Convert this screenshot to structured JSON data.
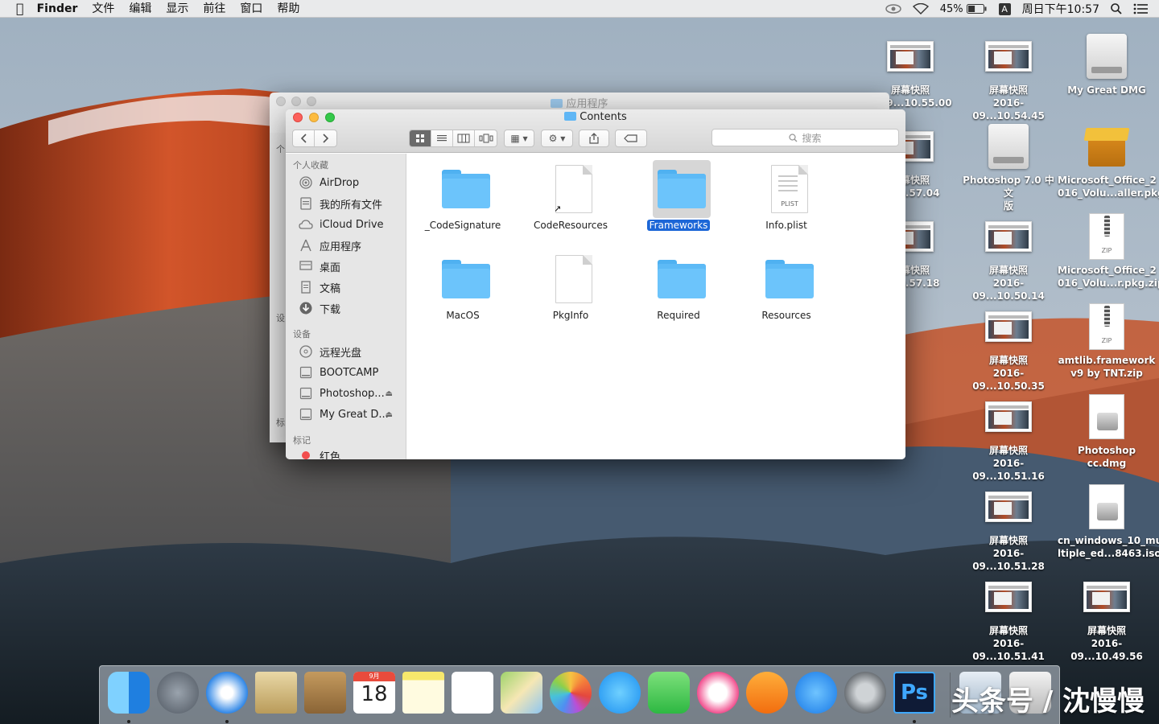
{
  "menubar": {
    "app_name": "Finder",
    "menus": [
      "文件",
      "编辑",
      "显示",
      "前往",
      "窗口",
      "帮助"
    ],
    "battery": "45%",
    "input_method": "A",
    "clock": "周日下午10:57"
  },
  "back_window": {
    "title": "应用程序",
    "sidebar_fragments": [
      "个",
      "设",
      "标"
    ]
  },
  "finder": {
    "title": "Contents",
    "search_placeholder": "搜索",
    "sidebar": {
      "favorites_header": "个人收藏",
      "favorites": [
        {
          "label": "AirDrop",
          "icon": "airdrop-icon"
        },
        {
          "label": "我的所有文件",
          "icon": "all-files-icon"
        },
        {
          "label": "iCloud Drive",
          "icon": "cloud-icon"
        },
        {
          "label": "应用程序",
          "icon": "applications-icon"
        },
        {
          "label": "桌面",
          "icon": "desktop-icon"
        },
        {
          "label": "文稿",
          "icon": "documents-icon"
        },
        {
          "label": "下载",
          "icon": "download-icon"
        }
      ],
      "devices_header": "设备",
      "devices": [
        {
          "label": "远程光盘",
          "icon": "disc-icon"
        },
        {
          "label": "BOOTCAMP",
          "icon": "drive-icon"
        },
        {
          "label": "Photoshop...",
          "icon": "drive-icon",
          "eject": true
        },
        {
          "label": "My Great D...",
          "icon": "drive-icon",
          "eject": true
        }
      ],
      "tags_header": "标记",
      "tags": [
        {
          "label": "红色",
          "color": "#f24e4e"
        }
      ]
    },
    "files": [
      {
        "name": "_CodeSignature",
        "kind": "folder"
      },
      {
        "name": "CodeResources",
        "kind": "alias-doc"
      },
      {
        "name": "Frameworks",
        "kind": "folder",
        "selected": true
      },
      {
        "name": "Info.plist",
        "kind": "plist",
        "badge": "PLIST"
      },
      {
        "name": "MacOS",
        "kind": "folder"
      },
      {
        "name": "PkgInfo",
        "kind": "doc"
      },
      {
        "name": "Required",
        "kind": "folder"
      },
      {
        "name": "Resources",
        "kind": "folder"
      }
    ]
  },
  "desktop_icons": [
    {
      "l1": "屏幕快照",
      "l2": "...09...10.55.00",
      "kind": "screenshot"
    },
    {
      "l1": "屏幕快照",
      "l2": "2016-09...10.54.45",
      "kind": "screenshot"
    },
    {
      "l1": "My Great DMG",
      "l2": "",
      "kind": "dmg"
    },
    {
      "l1": "屏幕快照",
      "l2": "...10.57.04",
      "kind": "screenshot"
    },
    {
      "l1": "Photoshop 7.0 中文",
      "l2": "版",
      "kind": "dmg"
    },
    {
      "l1": "Microsoft_Office_2",
      "l2": "016_Volu...aller.pkg",
      "kind": "pkg"
    },
    {
      "l1": "屏幕快照",
      "l2": "...10.57.18",
      "kind": "screenshot"
    },
    {
      "l1": "屏幕快照",
      "l2": "2016-09...10.50.14",
      "kind": "screenshot"
    },
    {
      "l1": "Microsoft_Office_2",
      "l2": "016_Volu...r.pkg.zip",
      "kind": "zip"
    },
    {
      "l1": "屏幕快照",
      "l2": "2016-09...10.50.35",
      "kind": "screenshot"
    },
    {
      "l1": "amtlib.framework",
      "l2": "v9 by TNT.zip",
      "kind": "zip"
    },
    {
      "l1": "屏幕快照",
      "l2": "2016-09...10.51.16",
      "kind": "screenshot"
    },
    {
      "l1": "Photoshop cc.dmg",
      "l2": "",
      "kind": "docdisk"
    },
    {
      "l1": "屏幕快照",
      "l2": "2016-09...10.51.28",
      "kind": "screenshot"
    },
    {
      "l1": "cn_windows_10_mu",
      "l2": "ltiple_ed...8463.iso",
      "kind": "docdisk"
    },
    {
      "l1": "屏幕快照",
      "l2": "2016-09...10.51.41",
      "kind": "screenshot"
    },
    {
      "l1": "屏幕快照",
      "l2": "2016-09...10.49.56",
      "kind": "screenshot"
    }
  ],
  "dock": {
    "apps": [
      {
        "name": "finder",
        "running": true
      },
      {
        "name": "launchpad",
        "running": false
      },
      {
        "name": "safari",
        "running": true
      },
      {
        "name": "mail",
        "running": false
      },
      {
        "name": "contacts",
        "running": false
      },
      {
        "name": "calendar",
        "running": false,
        "month": "9月",
        "day": "18"
      },
      {
        "name": "notes",
        "running": false
      },
      {
        "name": "reminders",
        "running": false
      },
      {
        "name": "maps",
        "running": false
      },
      {
        "name": "photos",
        "running": false
      },
      {
        "name": "messages",
        "running": false
      },
      {
        "name": "facetime",
        "running": false
      },
      {
        "name": "itunes",
        "running": false
      },
      {
        "name": "ibooks",
        "running": false
      },
      {
        "name": "app-store",
        "running": false
      },
      {
        "name": "system-preferences",
        "running": false
      },
      {
        "name": "photoshop",
        "running": true,
        "label": "Ps"
      }
    ],
    "watermark": "头条号 / 沈慢慢"
  }
}
